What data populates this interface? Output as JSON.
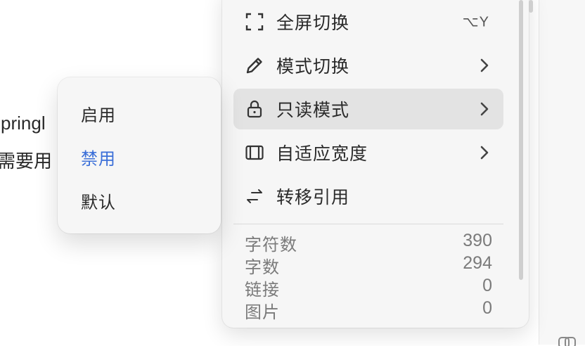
{
  "document": {
    "line1": "springl",
    "line2": "需要用"
  },
  "menu": {
    "items": [
      {
        "label": "全屏切换",
        "icon": "fullscreen-icon",
        "shortcut": "⌥Y"
      },
      {
        "label": "模式切换",
        "icon": "pencil-icon",
        "chevron": true
      },
      {
        "label": "只读模式",
        "icon": "lock-icon",
        "chevron": true,
        "active": true
      },
      {
        "label": "自适应宽度",
        "icon": "adaptive-width-icon",
        "chevron": true
      },
      {
        "label": "转移引用",
        "icon": "transfer-arrows-icon"
      }
    ],
    "stats": [
      {
        "label": "字符数",
        "value": "390"
      },
      {
        "label": "字数",
        "value": "294"
      },
      {
        "label": "链接",
        "value": "0"
      },
      {
        "label": "图片",
        "value": "0"
      }
    ]
  },
  "submenu": {
    "options": [
      "启用",
      "禁用",
      "默认"
    ],
    "selected": "禁用"
  },
  "colors": {
    "accent": "#3b6fd8",
    "menu_bg": "#f6f6f6",
    "active_bg": "#e3e3e3"
  }
}
